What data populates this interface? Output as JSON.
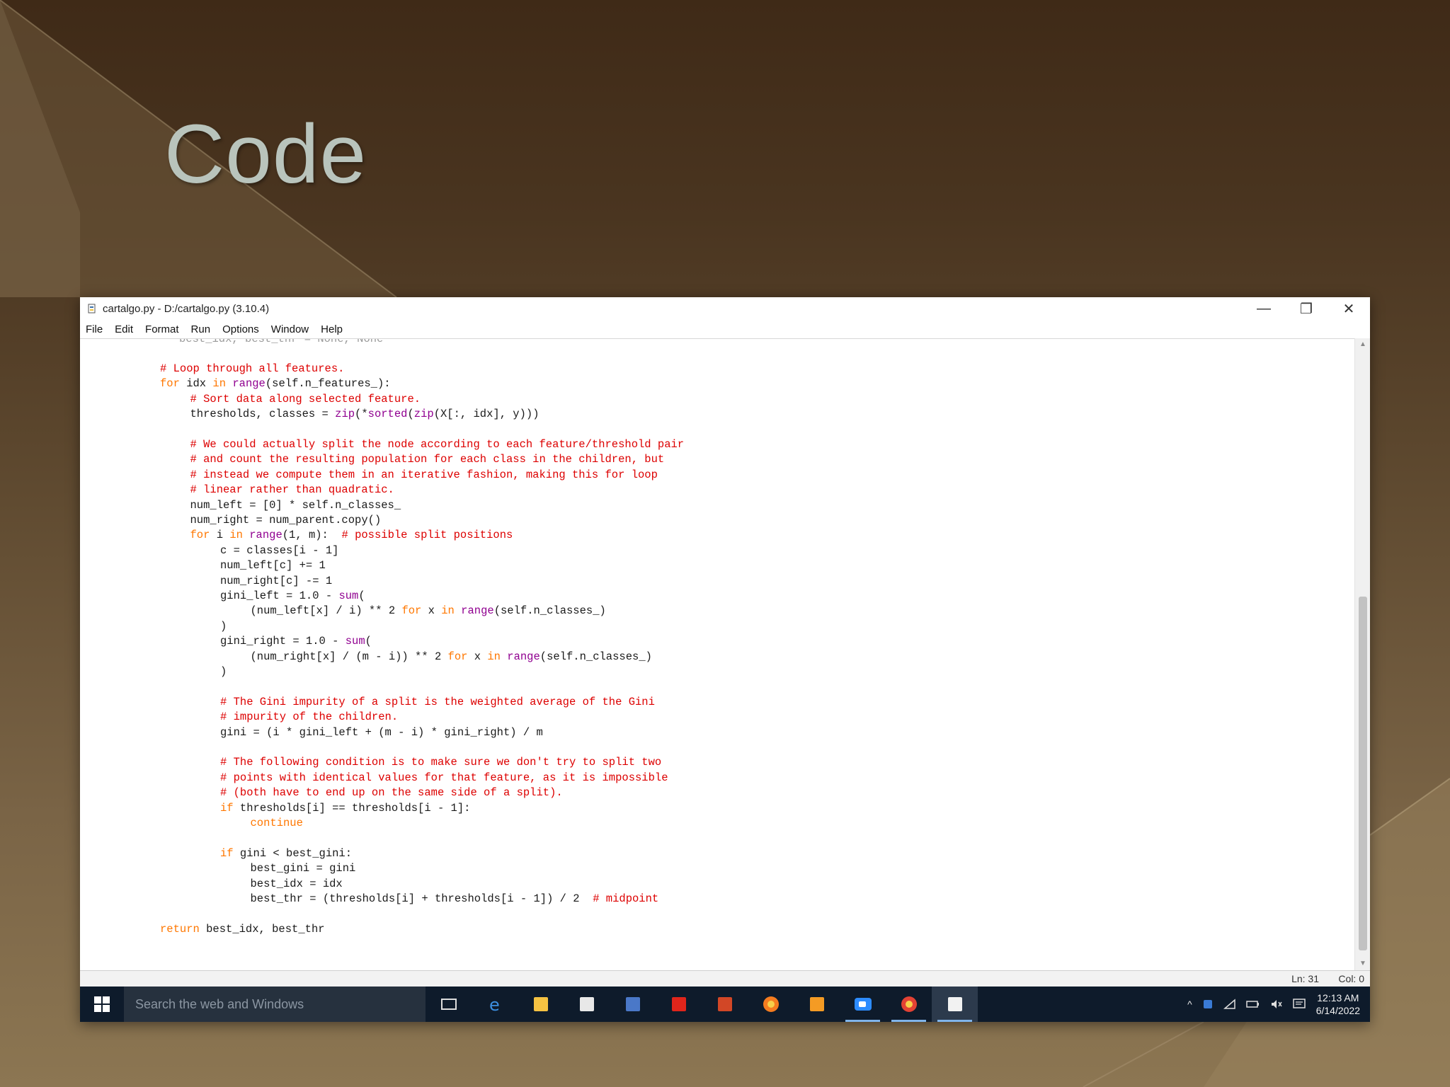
{
  "slide": {
    "title": "Code"
  },
  "window": {
    "title": "cartalgo.py - D:/cartalgo.py (3.10.4)",
    "controls": {
      "minimize": "—",
      "restore": "❐",
      "close": "✕"
    },
    "menu": [
      "File",
      "Edit",
      "Format",
      "Run",
      "Options",
      "Window",
      "Help"
    ]
  },
  "code": {
    "partial_top": "best_idx, best_thr = None, None",
    "lines": [
      {
        "indent": 1,
        "parts": [
          [
            "cm",
            "# Loop through all features."
          ]
        ]
      },
      {
        "indent": 1,
        "parts": [
          [
            "kw",
            "for"
          ],
          [
            "",
            " idx "
          ],
          [
            "kw",
            "in"
          ],
          [
            "",
            " "
          ],
          [
            "bi",
            "range"
          ],
          [
            "",
            "(self.n_features_):"
          ]
        ]
      },
      {
        "indent": 2,
        "parts": [
          [
            "cm",
            "# Sort data along selected feature."
          ]
        ]
      },
      {
        "indent": 2,
        "parts": [
          [
            "",
            "thresholds, classes = "
          ],
          [
            "bi",
            "zip"
          ],
          [
            "",
            "(*"
          ],
          [
            "bi",
            "sorted"
          ],
          [
            "",
            "("
          ],
          [
            "bi",
            "zip"
          ],
          [
            "",
            "(X[:, idx], y)))"
          ]
        ]
      },
      {
        "indent": 0,
        "parts": []
      },
      {
        "indent": 2,
        "parts": [
          [
            "cm",
            "# We could actually split the node according to each feature/threshold pair"
          ]
        ]
      },
      {
        "indent": 2,
        "parts": [
          [
            "cm",
            "# and count the resulting population for each class in the children, but"
          ]
        ]
      },
      {
        "indent": 2,
        "parts": [
          [
            "cm",
            "# instead we compute them in an iterative fashion, making this for loop"
          ]
        ]
      },
      {
        "indent": 2,
        "parts": [
          [
            "cm",
            "# linear rather than quadratic."
          ]
        ]
      },
      {
        "indent": 2,
        "parts": [
          [
            "",
            "num_left = [0] * self.n_classes_"
          ]
        ]
      },
      {
        "indent": 2,
        "parts": [
          [
            "",
            "num_right = num_parent.copy()"
          ]
        ]
      },
      {
        "indent": 2,
        "parts": [
          [
            "kw",
            "for"
          ],
          [
            "",
            " i "
          ],
          [
            "kw",
            "in"
          ],
          [
            "",
            " "
          ],
          [
            "bi",
            "range"
          ],
          [
            "",
            "(1, m):  "
          ],
          [
            "cm",
            "# possible split positions"
          ]
        ]
      },
      {
        "indent": 3,
        "parts": [
          [
            "",
            "c = classes[i - 1]"
          ]
        ]
      },
      {
        "indent": 3,
        "parts": [
          [
            "",
            "num_left[c] += 1"
          ]
        ]
      },
      {
        "indent": 3,
        "parts": [
          [
            "",
            "num_right[c] -= 1"
          ]
        ]
      },
      {
        "indent": 3,
        "parts": [
          [
            "",
            "gini_left = 1.0 - "
          ],
          [
            "bi",
            "sum"
          ],
          [
            "",
            "("
          ]
        ]
      },
      {
        "indent": 4,
        "parts": [
          [
            "",
            "(num_left[x] / i) ** 2 "
          ],
          [
            "kw",
            "for"
          ],
          [
            "",
            " x "
          ],
          [
            "kw",
            "in"
          ],
          [
            "",
            " "
          ],
          [
            "bi",
            "range"
          ],
          [
            "",
            "(self.n_classes_)"
          ]
        ]
      },
      {
        "indent": 3,
        "parts": [
          [
            "",
            ")"
          ]
        ]
      },
      {
        "indent": 3,
        "parts": [
          [
            "",
            "gini_right = 1.0 - "
          ],
          [
            "bi",
            "sum"
          ],
          [
            "",
            "("
          ]
        ]
      },
      {
        "indent": 4,
        "parts": [
          [
            "",
            "(num_right[x] / (m - i)) ** 2 "
          ],
          [
            "kw",
            "for"
          ],
          [
            "",
            " x "
          ],
          [
            "kw",
            "in"
          ],
          [
            "",
            " "
          ],
          [
            "bi",
            "range"
          ],
          [
            "",
            "(self.n_classes_)"
          ]
        ]
      },
      {
        "indent": 3,
        "parts": [
          [
            "",
            ")"
          ]
        ]
      },
      {
        "indent": 0,
        "parts": []
      },
      {
        "indent": 3,
        "parts": [
          [
            "cm",
            "# The Gini impurity of a split is the weighted average of the Gini"
          ]
        ]
      },
      {
        "indent": 3,
        "parts": [
          [
            "cm",
            "# impurity of the children."
          ]
        ]
      },
      {
        "indent": 3,
        "parts": [
          [
            "",
            "gini = (i * gini_left + (m - i) * gini_right) / m"
          ]
        ]
      },
      {
        "indent": 0,
        "parts": []
      },
      {
        "indent": 3,
        "parts": [
          [
            "cm",
            "# The following condition is to make sure we don't try to split two"
          ]
        ]
      },
      {
        "indent": 3,
        "parts": [
          [
            "cm",
            "# points with identical values for that feature, as it is impossible"
          ]
        ]
      },
      {
        "indent": 3,
        "parts": [
          [
            "cm",
            "# (both have to end up on the same side of a split)."
          ]
        ]
      },
      {
        "indent": 3,
        "parts": [
          [
            "kw",
            "if"
          ],
          [
            "",
            " thresholds[i] == thresholds[i - 1]:"
          ]
        ]
      },
      {
        "indent": 4,
        "parts": [
          [
            "kw",
            "continue"
          ]
        ]
      },
      {
        "indent": 0,
        "parts": []
      },
      {
        "indent": 3,
        "parts": [
          [
            "kw",
            "if"
          ],
          [
            "",
            " gini < best_gini:"
          ]
        ]
      },
      {
        "indent": 4,
        "parts": [
          [
            "",
            "best_gini = gini"
          ]
        ]
      },
      {
        "indent": 4,
        "parts": [
          [
            "",
            "best_idx = idx"
          ]
        ]
      },
      {
        "indent": 4,
        "parts": [
          [
            "",
            "best_thr = (thresholds[i] + thresholds[i - 1]) / 2  "
          ],
          [
            "cm",
            "# midpoint"
          ]
        ]
      },
      {
        "indent": 0,
        "parts": []
      },
      {
        "indent": 1,
        "parts": [
          [
            "kw",
            "return"
          ],
          [
            "",
            " best_idx, best_thr"
          ]
        ]
      }
    ]
  },
  "status": {
    "line": "Ln: 31",
    "col": "Col: 0"
  },
  "taskbar": {
    "search_placeholder": "Search the web and Windows",
    "apps": [
      {
        "icon": "task-view-icon",
        "color": "#dddddd"
      },
      {
        "icon": "edge-icon",
        "color": "#3c8fe0"
      },
      {
        "icon": "file-explorer-icon",
        "color": "#f5c242"
      },
      {
        "icon": "store-icon",
        "color": "#e8e8e8"
      },
      {
        "icon": "word-icon",
        "color": "#4a78c8"
      },
      {
        "icon": "acrobat-icon",
        "color": "#e0251b"
      },
      {
        "icon": "powerpoint-icon",
        "color": "#d24726"
      },
      {
        "icon": "firefox-icon",
        "color": "#f57c1f"
      },
      {
        "icon": "app-orange-icon",
        "color": "#f49b24"
      },
      {
        "icon": "zoom-icon",
        "color": "#2d8cff"
      },
      {
        "icon": "chrome-icon",
        "color": "#e34234"
      },
      {
        "icon": "python-idle-icon",
        "color": "#f2f2f2"
      }
    ],
    "clock": {
      "time": "12:13 AM",
      "date": "6/14/2022"
    }
  }
}
